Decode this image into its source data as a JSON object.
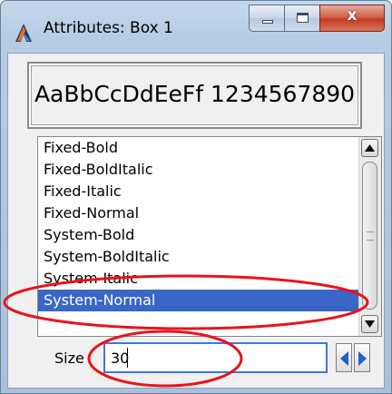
{
  "window": {
    "title": "Attributes: Box 1",
    "close_glyph": "x"
  },
  "icons": {
    "app": "application-logo-icon",
    "minimize": "minimize-icon",
    "maximize": "maximize-icon",
    "close": "close-icon",
    "scroll_up": "arrow-up-icon",
    "scroll_down": "arrow-down-icon",
    "decrement": "arrow-left-icon",
    "increment": "arrow-right-icon"
  },
  "preview": {
    "sample_text": "AaBbCcDdEeFf 1234567890"
  },
  "font_list": {
    "items": [
      "Fixed-Bold",
      "Fixed-BoldItalic",
      "Fixed-Italic",
      "Fixed-Normal",
      "System-Bold",
      "System-BoldItalic",
      "System-Italic",
      "System-Normal"
    ],
    "selected": "System-Normal"
  },
  "size": {
    "label": "Size",
    "value": "30"
  },
  "colors": {
    "selection": "#3a66c8",
    "annotation": "#e8141c",
    "input_focus": "#3e7ad6",
    "stepper_arrow": "#1f5fd0"
  }
}
